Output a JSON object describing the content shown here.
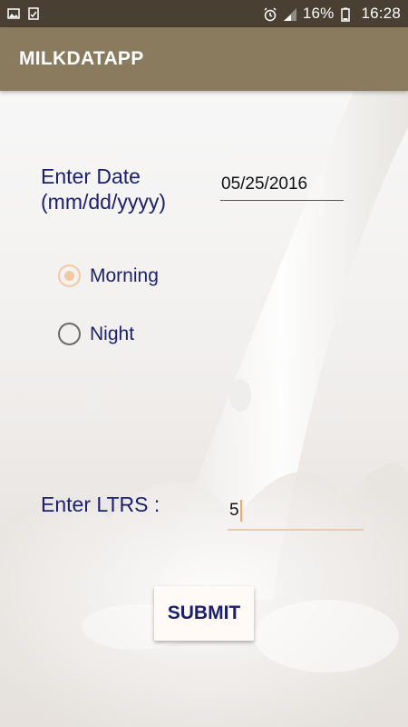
{
  "status_bar": {
    "left_icons": [
      "image-icon",
      "clipboard-check-icon"
    ],
    "right_icons": [
      "alarm-icon",
      "signal-icon",
      "battery-icon"
    ],
    "battery": "16%",
    "time": "16:28"
  },
  "app_bar": {
    "title": "MILKDATAPP"
  },
  "form": {
    "date_label_line1": "Enter Date",
    "date_label_line2": "(mm/dd/yyyy)",
    "date_value": "05/25/2016",
    "shift_options": [
      {
        "label": "Morning",
        "checked": true
      },
      {
        "label": "Night",
        "checked": false
      }
    ],
    "ltrs_label": "Enter LTRS :",
    "ltrs_value": "5",
    "submit_label": "SUBMIT"
  },
  "colors": {
    "status_bar": "#4a3f33",
    "app_bar": "#8b7b5e",
    "label_text": "#1a1f6e",
    "accent": "#f3c9a3"
  }
}
